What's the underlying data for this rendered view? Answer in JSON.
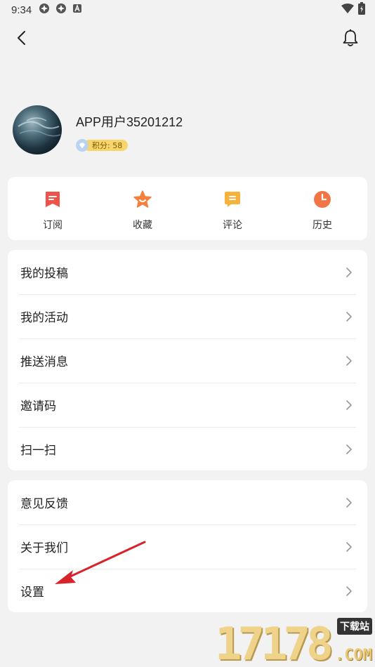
{
  "status_bar": {
    "time": "9:34"
  },
  "profile": {
    "username": "APP用户35201212",
    "points_label": "积分: 58"
  },
  "quick_actions": [
    {
      "label": "订阅",
      "icon": "subscribe-icon",
      "color": "#f0524a"
    },
    {
      "label": "收藏",
      "icon": "star-icon",
      "color": "#f5803e"
    },
    {
      "label": "评论",
      "icon": "comment-icon",
      "color": "#f6b23b"
    },
    {
      "label": "历史",
      "icon": "clock-icon",
      "color": "#f27645"
    }
  ],
  "menu_group_1": [
    {
      "label": "我的投稿"
    },
    {
      "label": "我的活动"
    },
    {
      "label": "推送消息"
    },
    {
      "label": "邀请码"
    },
    {
      "label": "扫一扫"
    }
  ],
  "menu_group_2": [
    {
      "label": "意见反馈"
    },
    {
      "label": "关于我们"
    },
    {
      "label": "设置"
    }
  ],
  "watermark": {
    "digits": "17178",
    "tag": "下载站",
    "suffix": ".COM"
  },
  "colors": {
    "background": "#f2f2f2",
    "card": "#ffffff",
    "annotation_arrow": "#d9232a",
    "points_badge": "#f8d56a"
  }
}
